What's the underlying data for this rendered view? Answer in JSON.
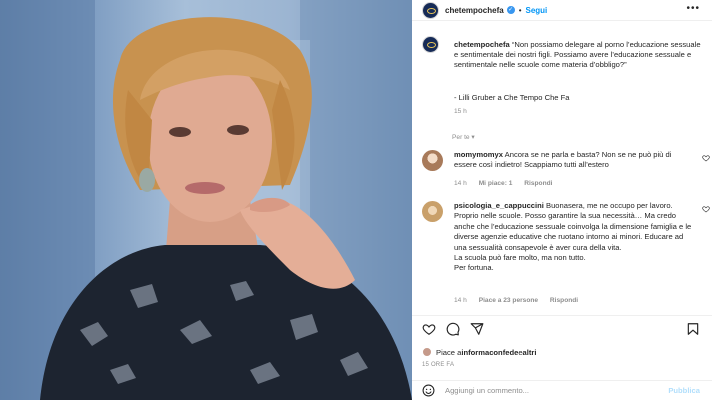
{
  "post": {
    "username": "chetempochefa",
    "dot": "•",
    "follow_label": "Segui",
    "more_label": "•••"
  },
  "caption": {
    "username": "chetempochefa",
    "text": "“Non possiamo delegare al porno l’educazione sessuale e sentimentale dei nostri figli. Possiamo avere l’educazione sessuale e sentimentale nelle scuole come materia d’obbligo?”",
    "author": "- Lilli Gruber a Che Tempo Che Fa",
    "time": "15 h"
  },
  "translate_label": "Per te ▾",
  "comments": [
    {
      "username": "momymomyx",
      "text": "Ancora se ne parla e basta? Non se ne può più di essere così indietro! Scappiamo tutti all’estero",
      "time": "14 h",
      "likes": "Mi piace: 1",
      "reply": "Rispondi"
    },
    {
      "username": "psicologia_e_cappuccini",
      "text": "Buonasera, me ne occupo per lavoro. Proprio nelle scuole. Posso garantire la sua necessità… Ma credo anche che l’educazione sessuale coinvolga la dimensione famiglia e le diverse agenzie educative che ruotano intorno ai minori. Educare ad una sessualità consapevole è aver cura della vita.",
      "text2": "La scuola può fare molto, ma non tutto.",
      "text3": "Per fortuna.",
      "time": "14 h",
      "likes": "Piace a 23 persone",
      "reply": "Rispondi"
    }
  ],
  "likes": {
    "prefix": "Piace a ",
    "user": "informaconfede",
    "middle": " e ",
    "others": "altri"
  },
  "time_ago": "15 ORE FA",
  "add_comment": {
    "placeholder": "Aggiungi un commento...",
    "publish_label": "Pubblica"
  },
  "icons": {
    "header_avatar": "brand-avatar-icon",
    "verified": "verified-badge-icon",
    "heart": "heart-icon",
    "comment": "comment-icon",
    "share": "share-icon",
    "save": "bookmark-icon",
    "emoji": "emoji-icon"
  },
  "colors": {
    "accent": "#0095f6",
    "muted": "#8e8e8e",
    "text": "#262626"
  }
}
